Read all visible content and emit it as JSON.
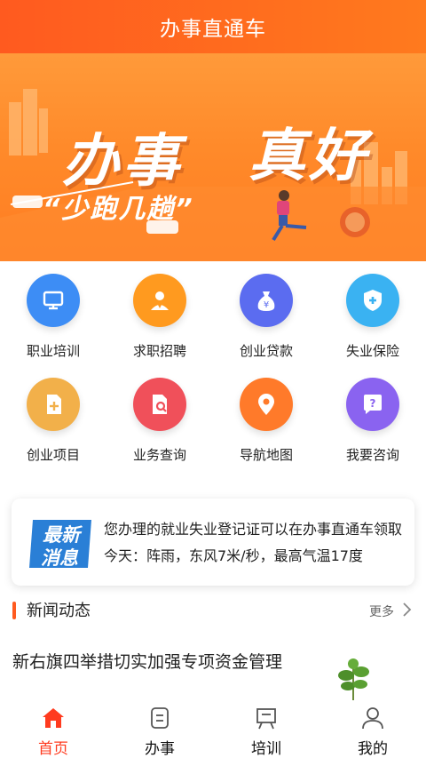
{
  "header": {
    "title": "办事直通车"
  },
  "banner": {
    "headline_left": "办事",
    "headline_right": "真好",
    "subline": "“少跑几趟”"
  },
  "services": [
    {
      "label": "职业培训",
      "icon": "presentation-board-icon",
      "color": "#3d8df5"
    },
    {
      "label": "求职招聘",
      "icon": "person-tie-icon",
      "color": "#ff9a1f"
    },
    {
      "label": "创业贷款",
      "icon": "money-bag-icon",
      "color": "#5b6cf0"
    },
    {
      "label": "失业保险",
      "icon": "shield-plus-icon",
      "color": "#3ab2f2"
    },
    {
      "label": "创业项目",
      "icon": "document-add-icon",
      "color": "#f2b04a"
    },
    {
      "label": "业务查询",
      "icon": "document-search-icon",
      "color": "#f0505a"
    },
    {
      "label": "导航地图",
      "icon": "map-pin-icon",
      "color": "#ff7a2a"
    },
    {
      "label": "我要咨询",
      "icon": "question-bubble-icon",
      "color": "#8a63f0"
    }
  ],
  "notice": {
    "badge_line1": "最新",
    "badge_line2": "消息",
    "lines": [
      "您办理的就业失业登记证可以在办事直通车领取",
      "今天：阵雨，东风7米/秒，最高气温17度"
    ]
  },
  "news": {
    "title": "新闻动态",
    "more": "更多",
    "article_title": "新右旗四举措切实加强专项资金管理"
  },
  "tabs": [
    {
      "label": "首页",
      "icon": "home-icon",
      "active": true
    },
    {
      "label": "办事",
      "icon": "document-list-icon",
      "active": false
    },
    {
      "label": "培训",
      "icon": "training-board-icon",
      "active": false
    },
    {
      "label": "我的",
      "icon": "user-icon",
      "active": false
    }
  ],
  "colors": {
    "brand": "#ff5a1f",
    "tab_active": "#ff3b1f"
  }
}
